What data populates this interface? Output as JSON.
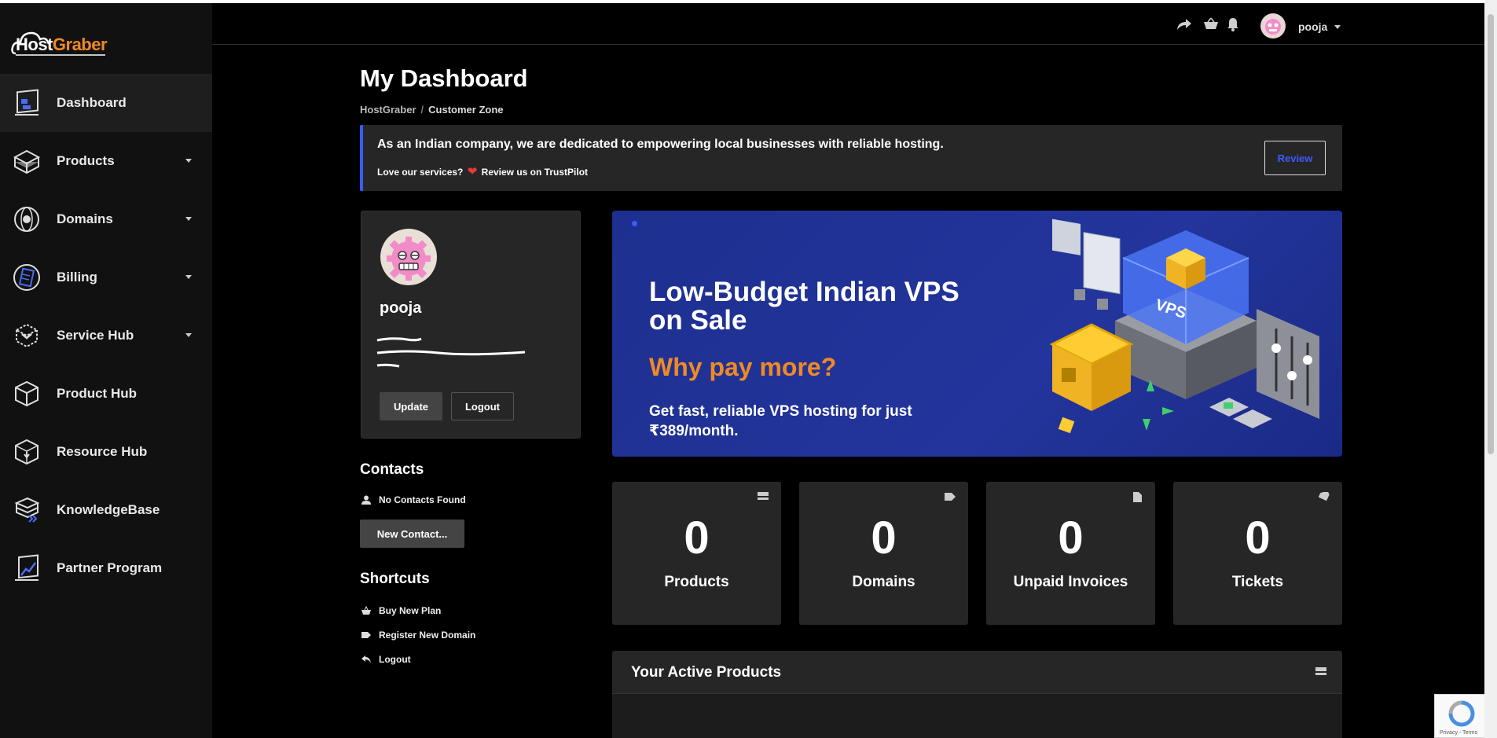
{
  "app": {
    "logo_text_a": "Host",
    "logo_text_b": "Graber",
    "brand_accent": "#f08a24",
    "primary": "#3d5afe"
  },
  "sidebar": {
    "items": [
      {
        "label": "Dashboard",
        "icon": "dashboard-icon",
        "active": true,
        "dropdown": false
      },
      {
        "label": "Products",
        "icon": "box-icon",
        "dropdown": true
      },
      {
        "label": "Domains",
        "icon": "globe-icon",
        "dropdown": true
      },
      {
        "label": "Billing",
        "icon": "invoice-icon",
        "dropdown": true
      },
      {
        "label": "Service Hub",
        "icon": "service-box-icon",
        "dropdown": true
      },
      {
        "label": "Product Hub",
        "icon": "cube-icon",
        "dropdown": false
      },
      {
        "label": "Resource Hub",
        "icon": "download-box-icon",
        "dropdown": false
      },
      {
        "label": "KnowledgeBase",
        "icon": "server-stack-icon",
        "dropdown": false
      },
      {
        "label": "Partner Program",
        "icon": "growth-chart-icon",
        "dropdown": false
      }
    ]
  },
  "header": {
    "icons": [
      "share-icon",
      "cart-icon",
      "bell-icon"
    ],
    "username": "pooja"
  },
  "main": {
    "title": "My Dashboard",
    "breadcrumb": [
      "HostGraber",
      "/",
      "Customer Zone"
    ]
  },
  "notice": {
    "line1": "As an Indian company, we are dedicated to empowering local businesses with reliable hosting.",
    "line2_a": "Love our services?",
    "line2_heart": "❤",
    "line2_b": "Review us on TrustPilot",
    "button": "Review"
  },
  "profile": {
    "name": "pooja",
    "update_label": "Update",
    "logout_label": "Logout"
  },
  "contacts": {
    "title": "Contacts",
    "empty_text": "No Contacts Found",
    "new_button": "New Contact..."
  },
  "shortcuts": {
    "title": "Shortcuts",
    "items": [
      {
        "label": "Buy New Plan",
        "icon": "basket-icon"
      },
      {
        "label": "Register New Domain",
        "icon": "tag-icon"
      },
      {
        "label": "Logout",
        "icon": "back-arrow-icon"
      }
    ]
  },
  "banner": {
    "headline": "Low-Budget Indian VPS on Sale",
    "subhead": "Why pay more?",
    "body": "Get fast, reliable VPS hosting for just ₹389/month.",
    "art_label": "VPS"
  },
  "stats": [
    {
      "value": "0",
      "label": "Products",
      "icon": "server-icon"
    },
    {
      "value": "0",
      "label": "Domains",
      "icon": "tag-icon"
    },
    {
      "value": "0",
      "label": "Unpaid Invoices",
      "icon": "document-icon"
    },
    {
      "value": "0",
      "label": "Tickets",
      "icon": "ticket-icon"
    }
  ],
  "active_products": {
    "title": "Your Active Products"
  },
  "recaptcha": {
    "footer": "Privacy - Terms"
  }
}
